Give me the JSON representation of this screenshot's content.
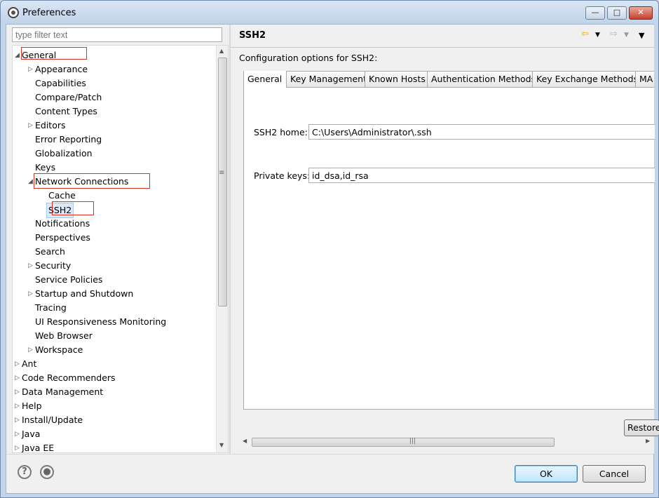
{
  "window": {
    "title": "Preferences"
  },
  "filter": {
    "placeholder": "type filter text"
  },
  "tree": [
    {
      "label": "General",
      "level": 0,
      "expanded": true,
      "hasChildren": true
    },
    {
      "label": "Appearance",
      "level": 1,
      "hasChildren": true
    },
    {
      "label": "Capabilities",
      "level": 1
    },
    {
      "label": "Compare/Patch",
      "level": 1
    },
    {
      "label": "Content Types",
      "level": 1
    },
    {
      "label": "Editors",
      "level": 1,
      "hasChildren": true
    },
    {
      "label": "Error Reporting",
      "level": 1
    },
    {
      "label": "Globalization",
      "level": 1
    },
    {
      "label": "Keys",
      "level": 1
    },
    {
      "label": "Network Connections",
      "level": 1,
      "expanded": true,
      "hasChildren": true
    },
    {
      "label": "Cache",
      "level": 2
    },
    {
      "label": "SSH2",
      "level": 2,
      "selected": true
    },
    {
      "label": "Notifications",
      "level": 1
    },
    {
      "label": "Perspectives",
      "level": 1
    },
    {
      "label": "Search",
      "level": 1
    },
    {
      "label": "Security",
      "level": 1,
      "hasChildren": true
    },
    {
      "label": "Service Policies",
      "level": 1
    },
    {
      "label": "Startup and Shutdown",
      "level": 1,
      "hasChildren": true
    },
    {
      "label": "Tracing",
      "level": 1
    },
    {
      "label": "UI Responsiveness Monitoring",
      "level": 1
    },
    {
      "label": "Web Browser",
      "level": 1
    },
    {
      "label": "Workspace",
      "level": 1,
      "hasChildren": true
    },
    {
      "label": "Ant",
      "level": 0,
      "hasChildren": true
    },
    {
      "label": "Code Recommenders",
      "level": 0,
      "hasChildren": true
    },
    {
      "label": "Data Management",
      "level": 0,
      "hasChildren": true
    },
    {
      "label": "Help",
      "level": 0,
      "hasChildren": true
    },
    {
      "label": "Install/Update",
      "level": 0,
      "hasChildren": true
    },
    {
      "label": "Java",
      "level": 0,
      "hasChildren": true
    },
    {
      "label": "Java EE",
      "level": 0,
      "hasChildren": true
    }
  ],
  "page": {
    "title": "SSH2",
    "description": "Configuration options for SSH2:",
    "tabs": [
      "General",
      "Key Management",
      "Known Hosts",
      "Authentication Methods",
      "Key Exchange Methods",
      "MA"
    ],
    "active_tab": "General",
    "ssh2_home_label": "SSH2 home:",
    "ssh2_home_value": "C:\\Users\\Administrator\\.ssh",
    "private_keys_label": "Private keys:",
    "private_keys_value": "id_dsa,id_rsa",
    "restore_label": "Restore Defaults"
  },
  "buttons": {
    "ok": "OK",
    "cancel": "Cancel"
  },
  "icons": {
    "back": "back-arrow-icon",
    "forward": "forward-arrow-icon",
    "menu": "view-menu-icon",
    "help": "help-icon",
    "import": "import-export-icon"
  },
  "colors": {
    "highlight": "#e0301e",
    "selection": "#dbe9fb",
    "accent_arrow": "#e8a800"
  }
}
